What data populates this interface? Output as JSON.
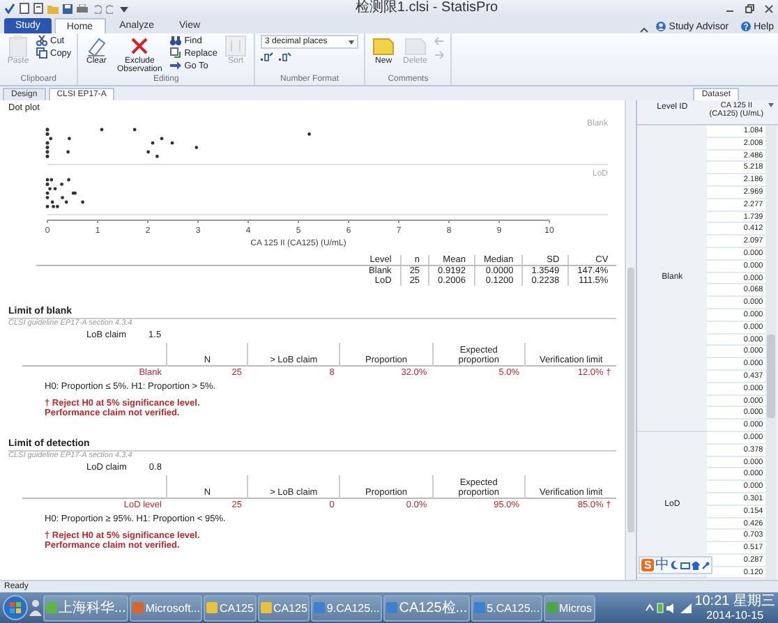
{
  "window": {
    "title": "检测限1.clsi - StatisPro"
  },
  "ribbon_tabs": [
    {
      "label": "Study",
      "kind": "app",
      "selected": false
    },
    {
      "label": "Home",
      "kind": "tab",
      "selected": true
    },
    {
      "label": "Analyze",
      "kind": "tab",
      "selected": false
    },
    {
      "label": "View",
      "kind": "tab",
      "selected": false
    }
  ],
  "help_links": [
    "Study Advisor",
    "Help"
  ],
  "ribbon_groups": [
    {
      "label": "Clipboard",
      "columns": [
        [
          {
            "kind": "large",
            "label": "Paste",
            "disabled": true
          }
        ],
        [
          {
            "kind": "small",
            "label": "Cut",
            "disabled": false
          },
          {
            "kind": "small",
            "label": "Copy",
            "disabled": false
          }
        ]
      ]
    },
    {
      "label": "Editing",
      "columns": [
        [
          {
            "kind": "large",
            "label": "Clear",
            "disabled": false
          }
        ],
        [
          {
            "kind": "large",
            "label": "Exclude Observation",
            "disabled": false
          }
        ],
        [
          {
            "kind": "small",
            "label": "Find",
            "disabled": false
          },
          {
            "kind": "small",
            "label": "Replace",
            "disabled": false
          },
          {
            "kind": "small",
            "label": "Go To",
            "disabled": false
          }
        ],
        [
          {
            "kind": "large",
            "label": "Sort",
            "disabled": true
          }
        ]
      ]
    },
    {
      "label": "Number Format",
      "columns": [
        [
          {
            "kind": "dropdown",
            "value": "3 decimal places"
          },
          {
            "kind": "icon",
            "disabled": false
          },
          {
            "kind": "icon",
            "disabled": false
          }
        ]
      ]
    },
    {
      "label": "Comments",
      "columns": [
        [
          {
            "kind": "large",
            "label": "New",
            "disabled": false
          }
        ],
        [
          {
            "kind": "large",
            "label": "Delete",
            "disabled": true
          }
        ],
        [
          {
            "kind": "icon",
            "disabled": true
          },
          {
            "kind": "icon",
            "disabled": true
          }
        ]
      ]
    }
  ],
  "doc_tabs": [
    {
      "label": "Design",
      "selected": false
    },
    {
      "label": "CLSI EP17-A",
      "selected": true
    }
  ],
  "dataset_tab": {
    "label": "Dataset",
    "selected": true
  },
  "report": {
    "dot_plot": {
      "title": "Dot plot",
      "band_labels": [
        "Blank",
        "LoD"
      ],
      "tick_labels": [
        "0",
        "1",
        "2",
        "3",
        "4",
        "5",
        "6",
        "7",
        "8",
        "9",
        "10"
      ],
      "axis_title": "CA 125 II (CA125) (U/mL)"
    },
    "summary_table": {
      "columns": [
        "Level",
        "n",
        "Mean",
        "Median",
        "SD",
        "CV"
      ],
      "rows": [
        [
          "Blank",
          "25",
          "0.9192",
          "0.0000",
          "1.3549",
          "147.4%"
        ],
        [
          "LoD",
          "25",
          "0.2006",
          "0.1200",
          "0.2238",
          "111.5%"
        ]
      ]
    },
    "sections": [
      {
        "title": "Limit of blank",
        "guideline": "CLSI guideline EP17-A section 4.3.4",
        "claim_label": "LoB claim",
        "claim_value": "1.5",
        "columns": [
          "",
          "N",
          "> LoB claim",
          "Proportion",
          "Expected proportion",
          "Verification limit"
        ],
        "rows": [
          {
            "cells": [
              "Blank",
              "25",
              "8",
              "32.0%",
              "5.0%",
              "12.0% †"
            ],
            "rejected": true
          }
        ],
        "hypothesis": "H0: Proportion ≤ 5%. H1: Proportion > 5%.",
        "notes": [
          "† Reject H0 at 5% significance level.",
          "Performance claim not verified."
        ]
      },
      {
        "title": "Limit of detection",
        "guideline": "CLSI guideline EP17-A section 4.3.4",
        "claim_label": "LoD claim",
        "claim_value": "0.8",
        "columns": [
          "",
          "N",
          "> LoB claim",
          "Proportion",
          "Expected proportion",
          "Verification limit"
        ],
        "rows": [
          {
            "cells": [
              "LoD level",
              "25",
              "0",
              "0.0%",
              "95.0%",
              "85.0% †"
            ],
            "rejected": true
          }
        ],
        "hypothesis": "H0: Proportion ≥ 95%. H1: Proportion < 95%.",
        "notes": [
          "† Reject H0 at 5% significance level.",
          "Performance claim not verified."
        ]
      }
    ]
  },
  "dataset": {
    "columns": [
      "Level ID",
      "CA 125 II (CA125) (U/mL)"
    ],
    "groups": [
      {
        "level": "Blank",
        "values": [
          "1.084",
          "2.008",
          "2.486",
          "5.218",
          "2.186",
          "2.969",
          "2.277",
          "1.739",
          "0.412",
          "2.097",
          "0.000",
          "0.000",
          "0.000",
          "0.068",
          "0.000",
          "0.000",
          "0.000",
          "0.000",
          "0.000",
          "0.000",
          "0.437",
          "0.000",
          "0.000",
          "0.000",
          "0.000"
        ]
      },
      {
        "level": "LoD",
        "values": [
          "0.000",
          "0.378",
          "0.000",
          "0.000",
          "0.000",
          "0.301",
          "0.154",
          "0.426",
          "0.703",
          "0.517",
          "0.287",
          "0.120"
        ]
      }
    ]
  },
  "ime_toolbar": {
    "logo": "S",
    "mode": "中"
  },
  "status_bar": "Ready",
  "taskbar": {
    "items": [
      {
        "label": "上海科华...",
        "selected": false
      },
      {
        "label": "Microsoft...",
        "selected": false
      },
      {
        "label": "CA125",
        "selected": false
      },
      {
        "label": "CA125",
        "selected": false
      },
      {
        "label": "9.CA125...",
        "selected": false
      },
      {
        "label": "CA125检...",
        "selected": false
      },
      {
        "label": "5.CA125...",
        "selected": false
      },
      {
        "label": "Micros",
        "selected": false
      }
    ],
    "clock": {
      "time": "10:21 星期三",
      "date": "2014-10-15"
    }
  }
}
